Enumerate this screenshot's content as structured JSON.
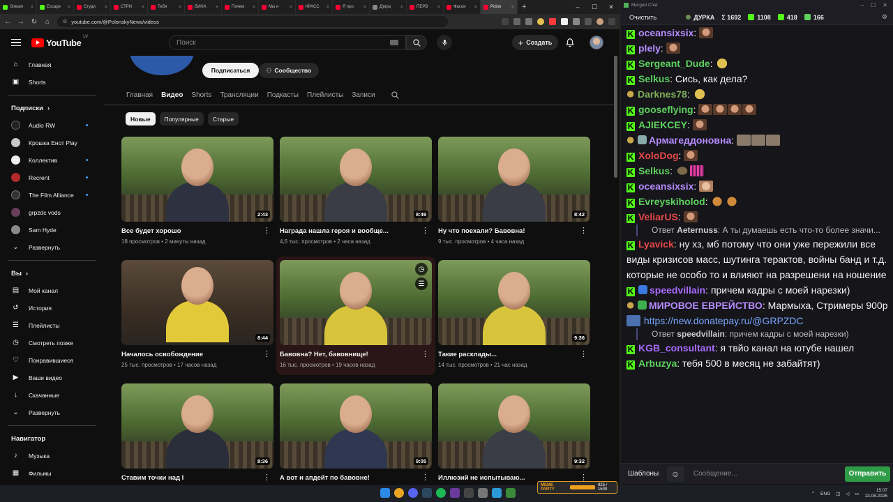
{
  "browser": {
    "tabs": [
      "Stream",
      "Escape",
      "Студи",
      "СТРИ",
      "Тебя",
      "БИНА",
      "Почем",
      "Мы н",
      "КРАСС",
      "Я про",
      "Д)ира",
      "ПЕРВ",
      "Фасон",
      "Polon"
    ],
    "url": "youtube.com/@PolonskyNews/videos"
  },
  "youtube": {
    "logo": "YouTube",
    "country": "LV",
    "search_placeholder": "Поиск",
    "create_label": "Создать",
    "subscribe_label": "Подписаться",
    "community_label": "Сообщество",
    "channel_tabs": [
      "Главная",
      "Видео",
      "Shorts",
      "Трансляции",
      "Подкасты",
      "Плейлисты",
      "Записи"
    ],
    "active_tab": "Видео",
    "chips": [
      "Новые",
      "Популярные",
      "Старые"
    ],
    "sidebar": {
      "main": [
        {
          "label": "Главная",
          "icon": "home-icon"
        },
        {
          "label": "Shorts",
          "icon": "shorts-icon"
        }
      ],
      "subs_header": "Подписки",
      "subs": [
        {
          "label": "Audio RW",
          "new": true,
          "color": "#222"
        },
        {
          "label": "Крошка Енот Play",
          "new": false,
          "color": "#c7c7c7"
        },
        {
          "label": "Коллектив",
          "new": true,
          "color": "#f1f1f1"
        },
        {
          "label": "Recrent",
          "new": true,
          "color": "#b12a2a"
        },
        {
          "label": "The Film Alliance",
          "new": true,
          "color": "#333"
        },
        {
          "label": "grpzdc vods",
          "new": false,
          "color": "#6a3d5a"
        },
        {
          "label": "Sam Hyde",
          "new": false,
          "color": "#8a8a8a"
        },
        {
          "label": "Развернуть",
          "new": false,
          "color": ""
        }
      ],
      "you_header": "Вы",
      "you": [
        {
          "label": "Мой канал",
          "icon": "channel-icon"
        },
        {
          "label": "История",
          "icon": "history-icon"
        },
        {
          "label": "Плейлисты",
          "icon": "playlists-icon"
        },
        {
          "label": "Смотреть позже",
          "icon": "watch-later-icon"
        },
        {
          "label": "Понравившиеся",
          "icon": "like-icon"
        },
        {
          "label": "Ваши видео",
          "icon": "your-videos-icon"
        },
        {
          "label": "Скачанные",
          "icon": "download-icon"
        },
        {
          "label": "Развернуть",
          "icon": "chevron-down-icon"
        }
      ],
      "nav_header": "Навигатор",
      "nav": [
        {
          "label": "Музыка",
          "icon": "music-icon"
        },
        {
          "label": "Фильмы",
          "icon": "movies-icon"
        }
      ]
    },
    "videos": [
      {
        "title": "Все будет хорошо",
        "views": "18 просмотров",
        "age": "2 минуты назад",
        "duration": "2:43"
      },
      {
        "title": "Награда нашла героя и вообще...",
        "views": "4,6 тыс. просмотров",
        "age": "2 часа назад",
        "duration": "8:49"
      },
      {
        "title": "Ну что поехали? Бавовна!",
        "views": "9 тыс. просмотров",
        "age": "4 часа назад",
        "duration": "8:42"
      },
      {
        "title": "Началось освобождение",
        "views": "25 тыс. просмотров",
        "age": "17 часов назад",
        "duration": "8:44"
      },
      {
        "title": "Бавовна? Нет, бавовнище!",
        "views": "16 тыс. просмотров",
        "age": "19 часов назад",
        "duration": ""
      },
      {
        "title": "Такие расклады...",
        "views": "14 тыс. просмотров",
        "age": "21 час назад",
        "duration": "9:36"
      },
      {
        "title": "Ставим точки над I",
        "views": "",
        "age": "",
        "duration": "8:36"
      },
      {
        "title": "А вот и апдейт по бавовне!",
        "views": "",
        "age": "",
        "duration": "9:05"
      },
      {
        "title": "Иллюзий не испытываю...",
        "views": "",
        "age": "",
        "duration": "9:32"
      }
    ]
  },
  "chat": {
    "window_title": "Merged Chat",
    "clear_label": "Очистить",
    "channel": "ДУРКА",
    "stats": {
      "total": "Σ 1692",
      "a": "1108",
      "b": "418",
      "c": "166"
    },
    "messages": [
      {
        "platform": "kick",
        "nick": "oceansixsix",
        "color": "#b58cff",
        "text": "",
        "emotes": 1
      },
      {
        "platform": "kick",
        "nick": "plely",
        "color": "#b58cff",
        "text": "",
        "emotes": 1
      },
      {
        "platform": "kick",
        "nick": "Sergeant_Dude",
        "color": "#5ed15e",
        "text": "",
        "emotes": 1
      },
      {
        "platform": "kick",
        "nick": "Selkus",
        "color": "#5ed15e",
        "text": "Сись, как дела?",
        "emotes": 0
      },
      {
        "platform": "twitch",
        "nick": "Darknes78",
        "color": "#7fae59",
        "text": "",
        "emotes": 1
      },
      {
        "platform": "kick",
        "nick": "gooseflying",
        "color": "#5ed15e",
        "text": "",
        "emotes": 4
      },
      {
        "platform": "kick",
        "nick": "AJIEKCEY",
        "color": "#5ed15e",
        "text": "",
        "emotes": 1
      },
      {
        "platform": "twitch",
        "nick": "Армагеддоновна",
        "color": "#b58cff",
        "text": "",
        "emotes": 3
      },
      {
        "platform": "kick",
        "nick": "XoloDog",
        "color": "#e64848",
        "text": "",
        "emotes": 1
      },
      {
        "platform": "kick",
        "nick": "Selkus",
        "color": "#5ed15e",
        "text": "",
        "emotes": 2
      },
      {
        "platform": "kick",
        "nick": "oceansixsix",
        "color": "#b58cff",
        "text": "",
        "emotes": 1
      },
      {
        "platform": "kick",
        "nick": "Evreyskiholod",
        "color": "#5ed15e",
        "text": "",
        "emotes": 2
      },
      {
        "platform": "kick",
        "nick": "VeliarUS",
        "color": "#e64848",
        "text": "",
        "emotes": 1
      }
    ],
    "reply1": {
      "prefix": "Ответ",
      "nick": "Aeternuss",
      "text": ": А ты думаешь есть что-то более значи..."
    },
    "lyavick": {
      "nick": "Lyavick",
      "color": "#e64848",
      "text": "ну хз, мб потому что они уже пережили все виды кризисов масс, шутинга терактов, войны банд и т.д. которые не особо то и влияют на разрешени на ношение"
    },
    "speed": {
      "nick": "speedvillain",
      "color": "#a96bff",
      "text": "причем кадры с моей нарезки)"
    },
    "world": {
      "nick": "МИРОВОЕ ЕВРЕЙСТВО",
      "color": "#b58cff",
      "text": "Мармыха, Стримеры 900р",
      "link": "https://new.donatepay.ru/@GRPZDC"
    },
    "reply2": {
      "prefix": "Ответ",
      "nick": "speedvillain",
      "text": ": причем кадры с моей нарезки)"
    },
    "kgb": {
      "nick": "KGB_consultant",
      "color": "#a96bff",
      "text": "я твйо канал на ютубе нашел"
    },
    "arbuzya": {
      "nick": "Arbuzya",
      "color": "#5ed15e",
      "text": "тебя 500 в месяц не забайтят)"
    },
    "templates_label": "Шаблоны",
    "input_placeholder": "Сообщение...",
    "send_label": "Отправить"
  },
  "taskbar": {
    "lang": "ENG",
    "time": "15:07",
    "date": "13.08.2026",
    "meme_label": "MEME PARTY",
    "meme_count": "925 / 1500"
  }
}
